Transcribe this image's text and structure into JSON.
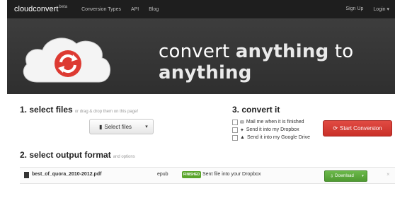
{
  "topbar": {
    "brand": "cloudconvert",
    "brand_sup": "beta",
    "nav": [
      "Conversion Types",
      "API",
      "Blog"
    ],
    "signup": "Sign Up",
    "login": "Login ▾"
  },
  "hero": {
    "headline_prefix": "convert ",
    "headline_word1": "anything",
    "headline_mid": " to ",
    "headline_word2": "anything"
  },
  "step1": {
    "title": "1. select files",
    "hint": "or drag & drop them on this page!",
    "select_button": "Select files",
    "dropdown": "▾"
  },
  "step3": {
    "title": "3. convert it",
    "options": [
      {
        "icon": "✉",
        "label": "Mail me when it is finished"
      },
      {
        "icon": "✦",
        "label": "Send it into my Dropbox"
      },
      {
        "icon": "▲",
        "label": "Send it into my Google Drive"
      }
    ],
    "start_button": "Start Conversion"
  },
  "step2": {
    "title": "2. select output format",
    "hint": "and options"
  },
  "file": {
    "name": "best_of_quora_2010-2012.pdf",
    "format": "epub",
    "badge": "FINISHED",
    "status": "Sent file into your Dropbox",
    "download": "Download",
    "caret": "▾",
    "close": "×"
  },
  "colors": {
    "topbar_bg": "#1e1e1e",
    "hero_bg": "#373737",
    "accent_red": "#d63a32",
    "accent_green": "#5aa52b"
  }
}
